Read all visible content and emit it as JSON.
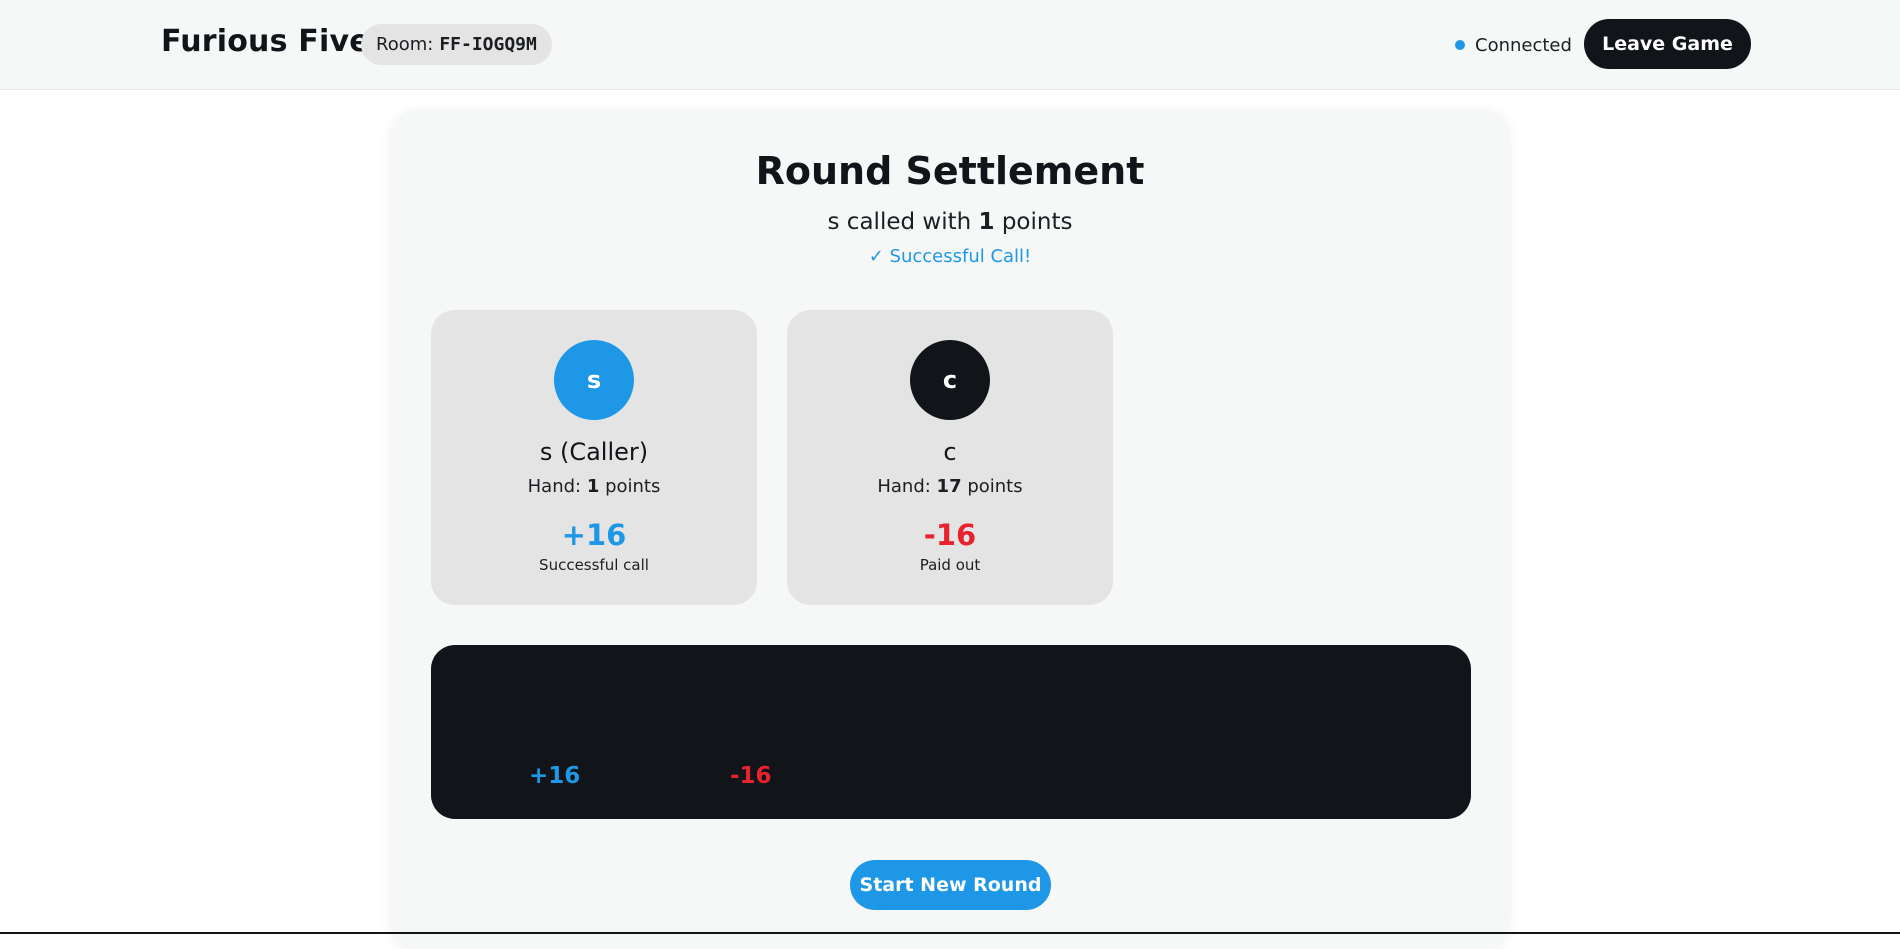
{
  "header": {
    "brand": "Furious Five",
    "room_label": "Room:",
    "room_code": "FF-IOGQ9M",
    "connection_status": "Connected",
    "leave_button": "Leave Game"
  },
  "settlement": {
    "title": "Round Settlement",
    "subtitle_prefix": "s called with ",
    "subtitle_points": "1",
    "subtitle_suffix": " points",
    "status": "✓ Successful Call!"
  },
  "players": [
    {
      "initial": "s",
      "name": "s (Caller)",
      "hand_label": "Hand: ",
      "hand_points": "1",
      "hand_suffix": " points",
      "delta": "+16",
      "note": "Successful call",
      "color": "#1e98e6"
    },
    {
      "initial": "c",
      "name": "c",
      "hand_label": "Hand: ",
      "hand_points": "17",
      "hand_suffix": " points",
      "delta": "-16",
      "note": "Paid out",
      "color": "#111418"
    }
  ],
  "chart_data": {
    "type": "bar",
    "values": [
      16,
      -16
    ],
    "labels": [
      "+16",
      "-16"
    ],
    "colors": [
      "#1e98e6",
      "#e8222e"
    ]
  },
  "actions": {
    "start_new_round": "Start New Round"
  },
  "colors": {
    "accent": "#1e98e6",
    "negative": "#e8222e",
    "dark": "#111418"
  }
}
